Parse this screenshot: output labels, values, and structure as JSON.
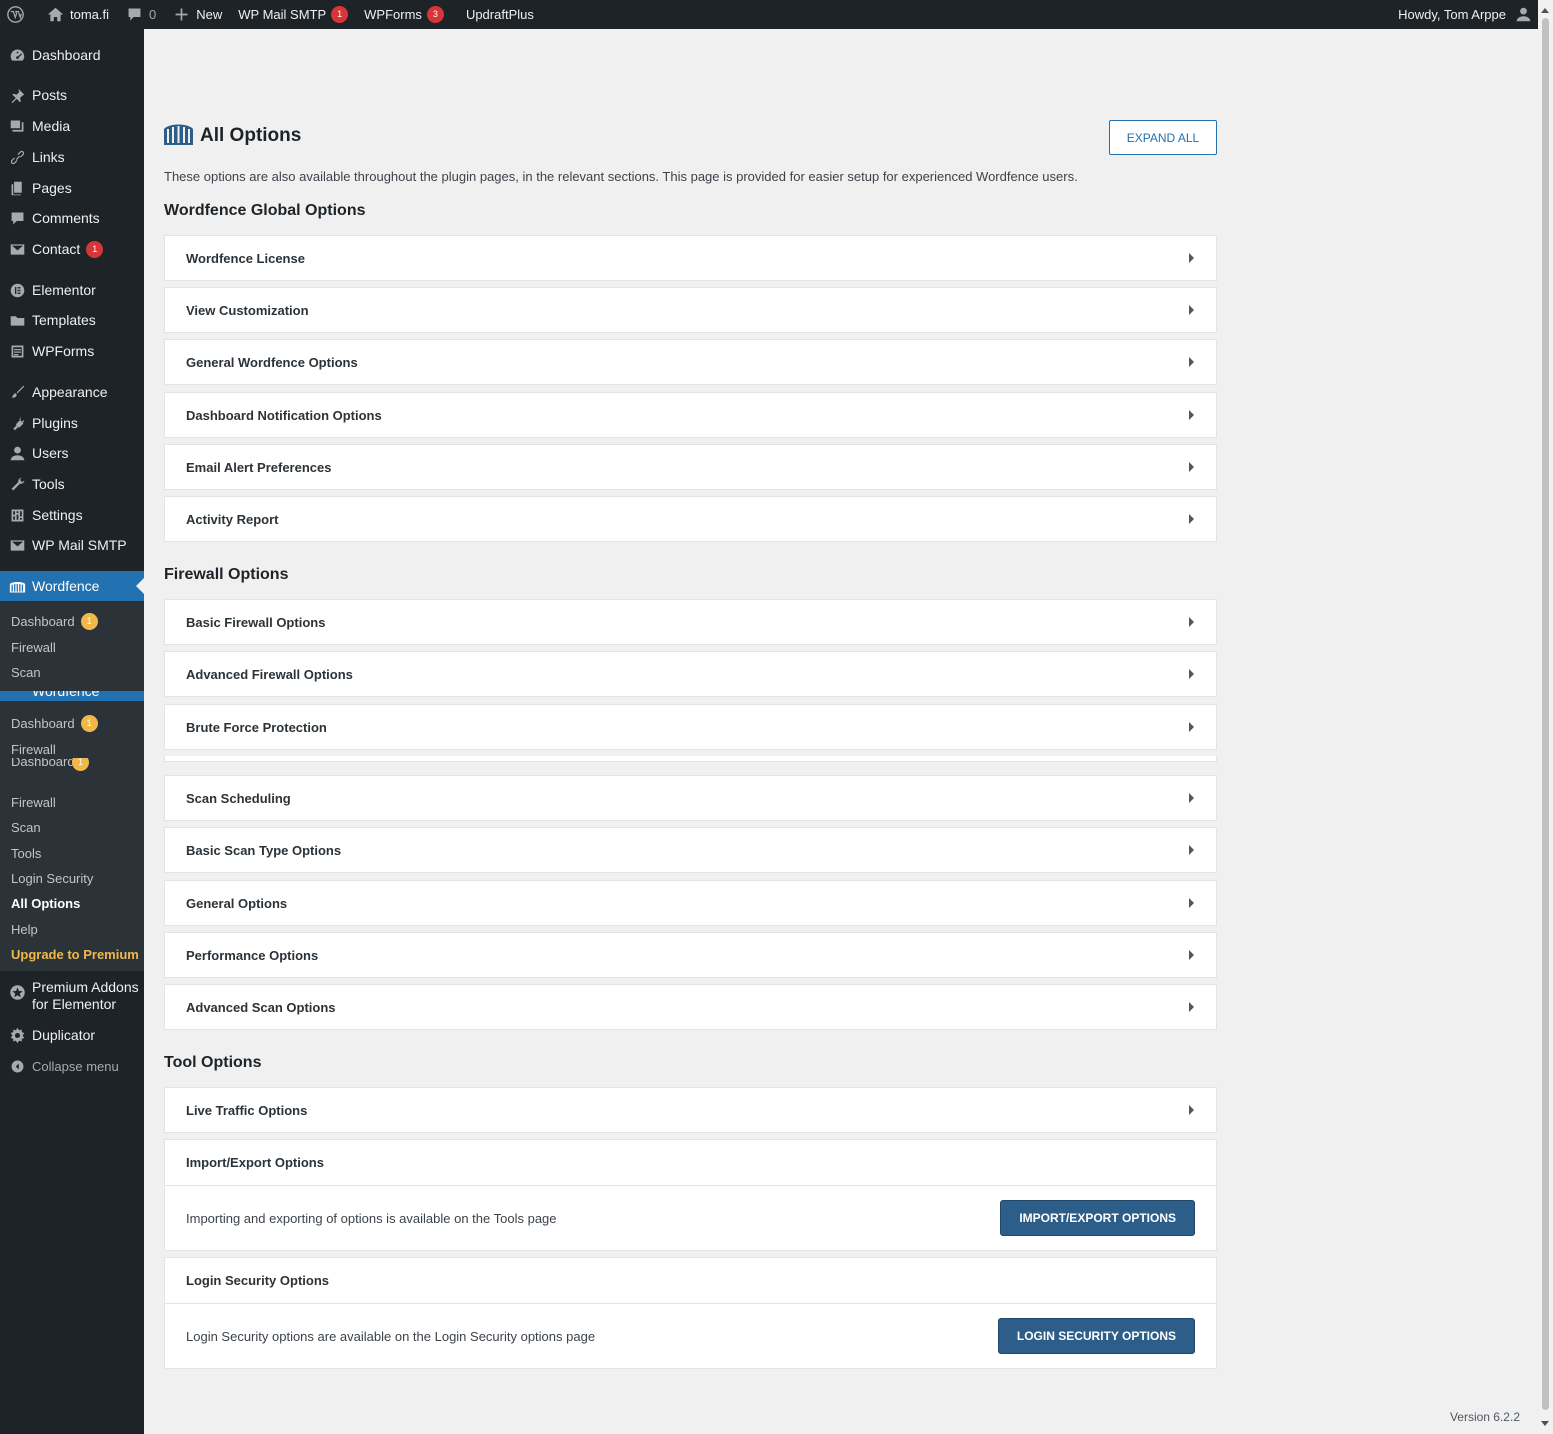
{
  "adminbar": {
    "site": "toma.fi",
    "comments_count": "0",
    "new_label": "New",
    "mailsmtp_label": "WP Mail SMTP",
    "mailsmtp_badge": "1",
    "wpforms_label": "WPForms",
    "wpforms_badge": "3",
    "updraft_label": "UpdraftPlus",
    "howdy": "Howdy, Tom Arppe"
  },
  "sidebar": {
    "dashboard": "Dashboard",
    "posts": "Posts",
    "media": "Media",
    "links": "Links",
    "pages": "Pages",
    "comments": "Comments",
    "contact": "Contact",
    "contact_badge": "1",
    "elementor": "Elementor",
    "templates": "Templates",
    "wpforms": "WPForms",
    "appearance": "Appearance",
    "plugins": "Plugins",
    "users": "Users",
    "tools": "Tools",
    "settings": "Settings",
    "wpmailsmtp": "WP Mail SMTP",
    "wordfence": "Wordfence",
    "sub": {
      "dashboard": "Dashboard",
      "dashboard_badge": "1",
      "firewall": "Firewall",
      "scan": "Scan",
      "tools": "Tools",
      "login_security": "Login Security",
      "all_options": "All Options",
      "help": "Help",
      "upgrade": "Upgrade to Premium"
    },
    "premium_addons_1": "Premium Addons",
    "premium_addons_2": "for Elementor",
    "duplicator": "Duplicator",
    "collapse": "Collapse menu"
  },
  "main": {
    "title": "All Options",
    "expand_all": "EXPAND ALL",
    "intro": "These options are also available throughout the plugin pages, in the relevant sections. This page is provided for easier setup for experienced Wordfence users.",
    "global_title": "Wordfence Global Options",
    "global_items": [
      "Wordfence License",
      "View Customization",
      "General Wordfence Options",
      "Dashboard Notification Options",
      "Email Alert Preferences",
      "Activity Report"
    ],
    "firewall_title": "Firewall Options",
    "firewall_items": [
      "Basic Firewall Options",
      "Advanced Firewall Options",
      "Brute Force Protection"
    ],
    "scan_items": [
      "Scan Scheduling",
      "Basic Scan Type Options",
      "General Options",
      "Performance Options",
      "Advanced Scan Options"
    ],
    "tool_title": "Tool Options",
    "live_traffic": "Live Traffic Options",
    "import_export": {
      "title": "Import/Export Options",
      "text": "Importing and exporting of options is available on the Tools page",
      "button": "IMPORT/EXPORT OPTIONS"
    },
    "login_security": {
      "title": "Login Security Options",
      "text": "Login Security options are available on the Login Security options page",
      "button": "LOGIN SECURITY OPTIONS"
    }
  },
  "footer": {
    "version": "Version 6.2.2"
  }
}
